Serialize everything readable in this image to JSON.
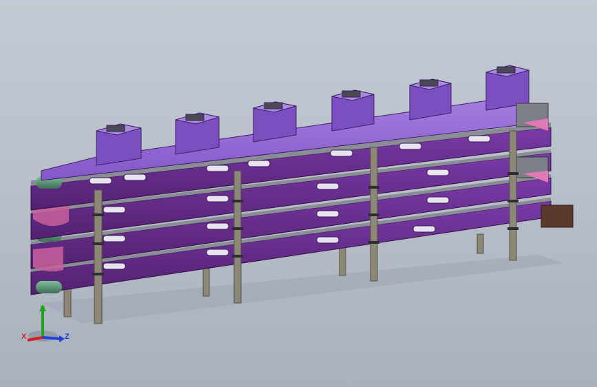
{
  "viewport": {
    "background_top": "#c4cad3",
    "background_bottom": "#a9b1bc",
    "model": {
      "tier_count": 4,
      "hopper_count": 6,
      "support_leg_count": 8,
      "colors": {
        "frame_purple": "#6e2f9a",
        "frame_dark": "#4a1d6e",
        "hopper_light": "#9b6fd8",
        "hopper_mid": "#7c4fc0",
        "hopper_shade": "#5d3699",
        "steel_grey": "#7d7f86",
        "leg_khaki": "#8c8776",
        "roller_green": "#4f8f6f",
        "roller_pink": "#c8609c",
        "motor_brown": "#5a3a2c"
      }
    }
  },
  "triad": {
    "x_label": "X",
    "y_label": "Y",
    "z_label": "Z",
    "x_color": "#d62020",
    "y_color": "#1fa31f",
    "z_color": "#1f3fd6",
    "icon": "coordinate-triad-icon"
  }
}
